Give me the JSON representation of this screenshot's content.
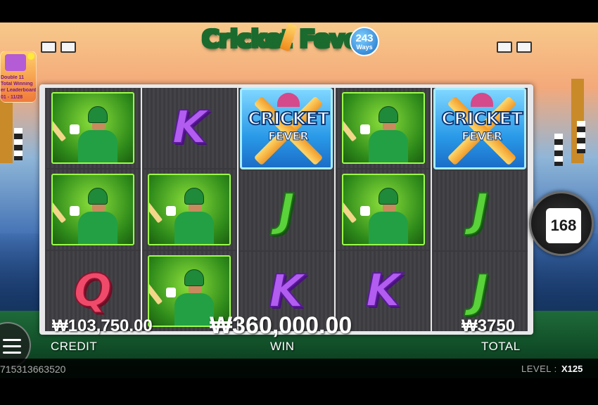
{
  "logo": {
    "title": "Cricket Fever",
    "ways_number": "243",
    "ways_label": "Ways"
  },
  "promo": {
    "lines": [
      "Double 11",
      "Total Winning",
      "er Leaderboard",
      "01 - 11/28"
    ]
  },
  "reels": [
    [
      "player",
      "player",
      "Q"
    ],
    [
      "K",
      "player",
      "player"
    ],
    [
      "wild",
      "J",
      "K"
    ],
    [
      "player",
      "player",
      "K"
    ],
    [
      "wild",
      "J",
      "J"
    ]
  ],
  "wild_symbol": {
    "line1": "CRICKET",
    "line2": "FEVER"
  },
  "auto_count": {
    "value": "168",
    "icon": "counter-icon"
  },
  "menu": {
    "icon": "hamburger-menu-icon"
  },
  "credit": {
    "value": "₩103,750.00",
    "label": "CREDIT"
  },
  "win": {
    "value": "₩360,000.00",
    "label": "WIN"
  },
  "total": {
    "value": "₩3750",
    "label": "TOTAL"
  },
  "status": {
    "id": "715313663520",
    "level_label": "LEVEL :",
    "level_value": "X125"
  },
  "colors": {
    "reel_bg": "#3c3c40",
    "frame": "#e8e8ea",
    "field": "#1f6b3a"
  }
}
